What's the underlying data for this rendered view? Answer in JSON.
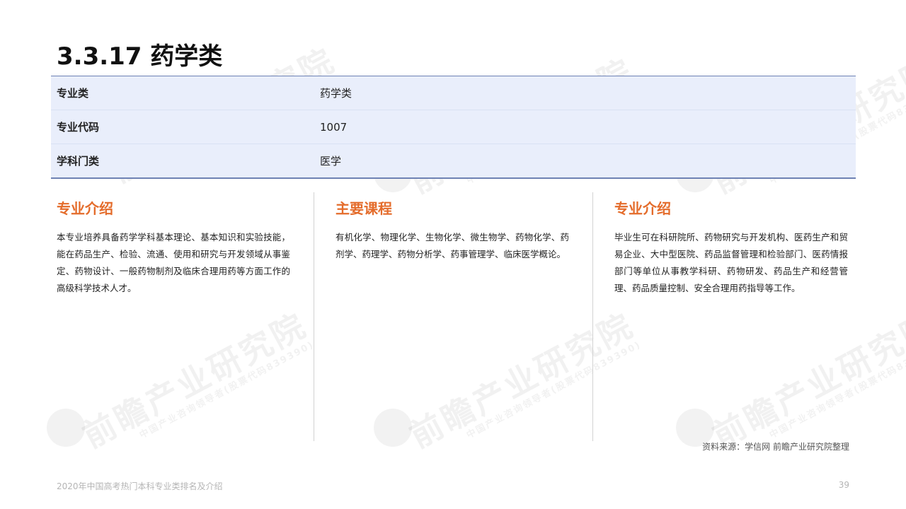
{
  "title": "3.3.17 药学类",
  "table": {
    "rows": [
      {
        "key": "专业类",
        "value": "药学类"
      },
      {
        "key": "专业代码",
        "value": "1007"
      },
      {
        "key": "学科门类",
        "value": "医学"
      }
    ]
  },
  "columns": [
    {
      "heading": "专业介绍",
      "body": "本专业培养具备药学学科基本理论、基本知识和实验技能，能在药品生产、检验、流通、使用和研究与开发领域从事鉴定、药物设计、一般药物制剂及临床合理用药等方面工作的高级科学技术人才。"
    },
    {
      "heading": "主要课程",
      "body": "有机化学、物理化学、生物化学、微生物学、药物化学、药剂学、药理学、药物分析学、药事管理学、临床医学概论。"
    },
    {
      "heading": "专业介绍",
      "body": "毕业生可在科研院所、药物研究与开发机构、医药生产和贸易企业、大中型医院、药品监督管理和检验部门、医药情报部门等单位从事教学科研、药物研发、药品生产和经营管理、药品质量控制、安全合理用药指导等工作。"
    }
  ],
  "source": "资料来源：学信网 前瞻产业研究院整理",
  "footer": {
    "report_title": "2020年中国高考热门本科专业类排名及介绍",
    "page_number": "39"
  },
  "watermark": {
    "main": "前瞻产业研究院",
    "sub": "中国产业咨询领导者(股票代码839390)"
  }
}
